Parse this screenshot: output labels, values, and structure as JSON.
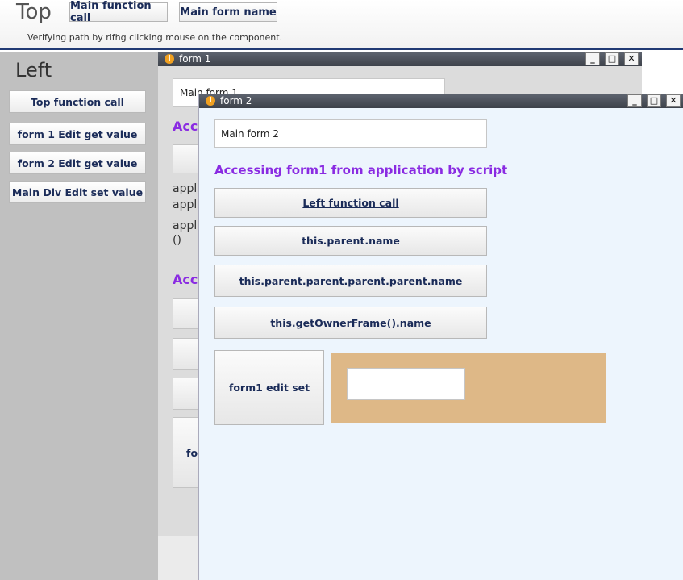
{
  "top": {
    "title": "Top",
    "main_function_call": "Main function call",
    "main_form_name": "Main form name",
    "hint": "Verifying path by rifhg clicking mouse on the component."
  },
  "left": {
    "title": "Left",
    "buttons": [
      "Top function call",
      "form 1 Edit get value",
      "form 2 Edit get value",
      "Main Div Edit  set value"
    ]
  },
  "form1": {
    "title": "form 1",
    "edit_value": "Main form 1",
    "heading_partial": "Acce",
    "text1": "appli",
    "text2": "appli",
    "text3": "appli",
    "text4": "()",
    "heading2_partial": "Acce",
    "btn_partial": "for"
  },
  "form2": {
    "title": "form 2",
    "edit_value": "Main form 2",
    "heading": "Accessing form1 from application by script",
    "buttons": [
      "Left function call",
      "this.parent.name",
      "this.parent.parent.parent.parent.name",
      "this.getOwnerFrame().name"
    ],
    "edit_set_button": "form1 edit set",
    "edit_set_value": ""
  },
  "colors": {
    "accent": "#8a2be2",
    "topbar_border": "#213a74",
    "panel": "#deb887",
    "form2_bg": "#edf5fd"
  },
  "icons": {
    "window": "info-icon",
    "minimize": "minimize-icon",
    "maximize": "maximize-icon",
    "close": "close-icon"
  }
}
